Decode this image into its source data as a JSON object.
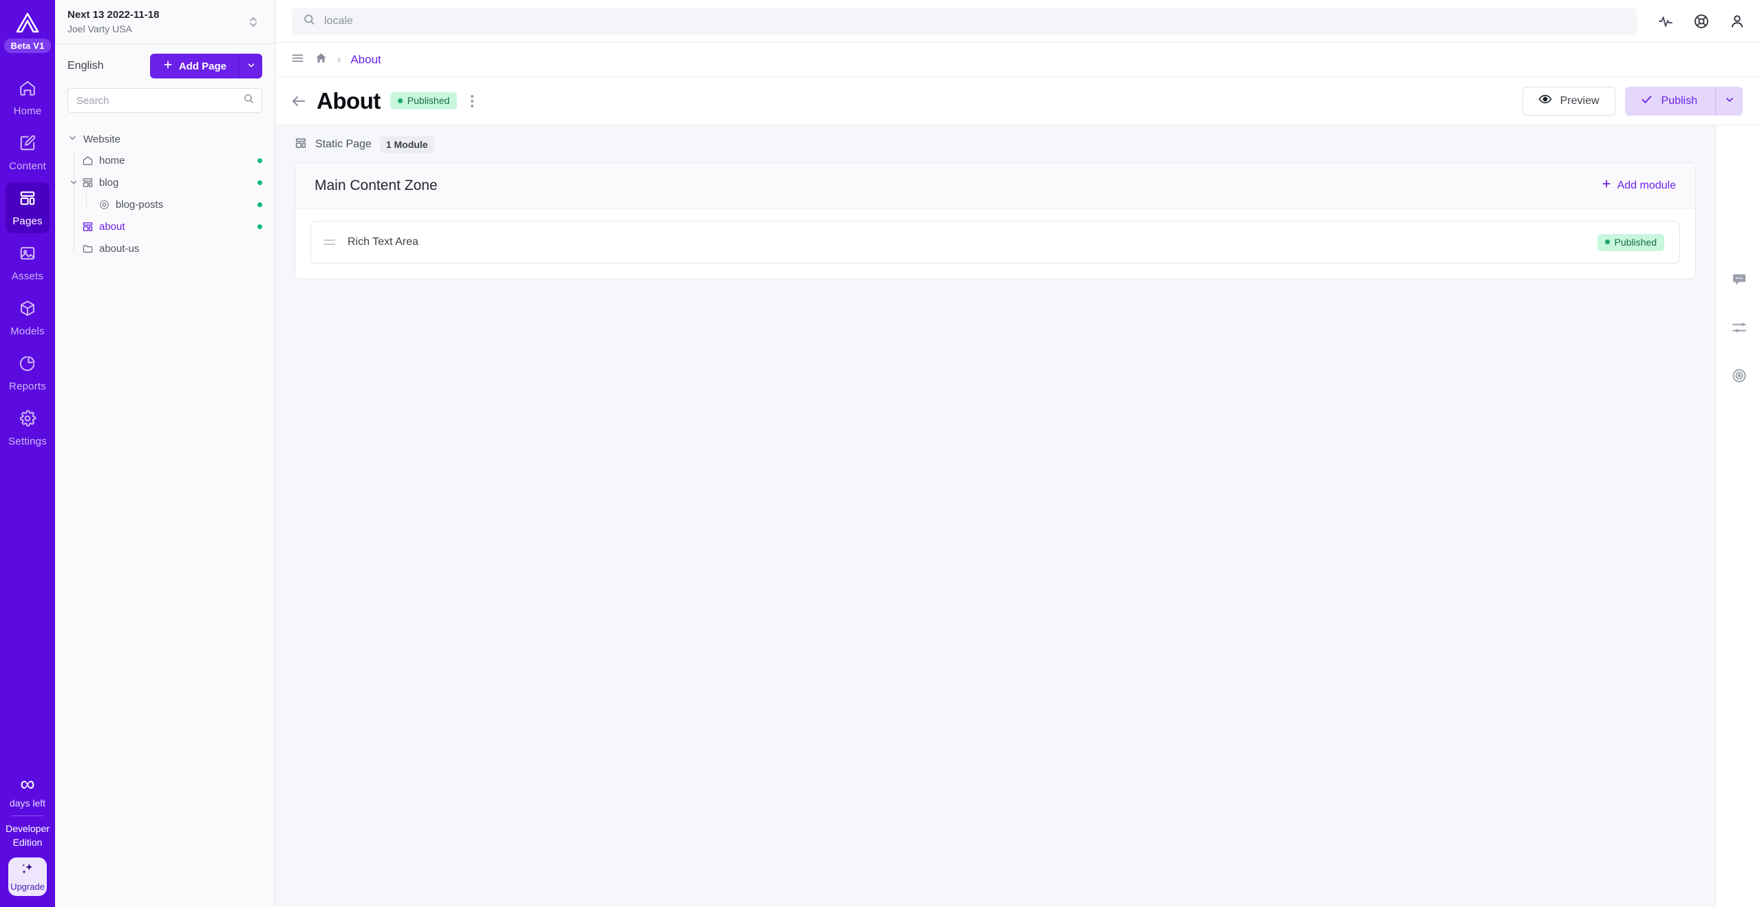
{
  "brand": {
    "beta_label": "Beta V1",
    "accent": "#6B21E8",
    "rail_bg": "#5B0BE0",
    "published_green": "#19A86B"
  },
  "rail": {
    "items": [
      {
        "label": "Home",
        "icon": "home-icon",
        "active": false
      },
      {
        "label": "Content",
        "icon": "edit-square-icon",
        "active": false
      },
      {
        "label": "Pages",
        "icon": "layout-icon",
        "active": true
      },
      {
        "label": "Assets",
        "icon": "image-icon",
        "active": false
      },
      {
        "label": "Models",
        "icon": "cube-icon",
        "active": false
      },
      {
        "label": "Reports",
        "icon": "pie-chart-icon",
        "active": false
      },
      {
        "label": "Settings",
        "icon": "gear-icon",
        "active": false
      }
    ],
    "footer": {
      "infinity": "∞",
      "days_left": "days left",
      "edition_line1": "Developer",
      "edition_line2": "Edition",
      "upgrade_label": "Upgrade"
    }
  },
  "tree_panel": {
    "site_name": "Next 13 2022-11-18",
    "site_sub": "Joel Varty USA",
    "language": "English",
    "add_page_label": "Add Page",
    "search_placeholder": "Search",
    "search_value": "",
    "root_label": "Website",
    "nodes": [
      {
        "label": "home",
        "icon": "home-icon",
        "level": 1,
        "selected": false,
        "expanded": false,
        "has_caret": false,
        "status_dot": true
      },
      {
        "label": "blog",
        "icon": "layout-icon",
        "level": 1,
        "selected": false,
        "expanded": true,
        "has_caret": true,
        "status_dot": true
      },
      {
        "label": "blog-posts",
        "icon": "dynamic-page-icon",
        "level": 2,
        "selected": false,
        "expanded": false,
        "has_caret": false,
        "status_dot": true
      },
      {
        "label": "about",
        "icon": "layout-icon",
        "level": 1,
        "selected": true,
        "expanded": false,
        "has_caret": false,
        "status_dot": true
      },
      {
        "label": "about-us",
        "icon": "folder-icon",
        "level": 1,
        "selected": false,
        "expanded": false,
        "has_caret": false,
        "status_dot": false
      }
    ]
  },
  "topbar": {
    "search_placeholder": "locale",
    "search_value": "",
    "icons": [
      "activity-icon",
      "lifebuoy-icon",
      "user-icon"
    ]
  },
  "breadcrumb": {
    "menu_icon": "hamburger-icon",
    "home_icon": "home-solid-icon",
    "separator": "›",
    "current": "About"
  },
  "page_header": {
    "title": "About",
    "status_badge": "Published",
    "preview_label": "Preview",
    "publish_label": "Publish"
  },
  "page_meta": {
    "type_label": "Static Page",
    "module_count_label": "1 Module"
  },
  "zone": {
    "title": "Main Content Zone",
    "add_module_label": "Add module",
    "modules": [
      {
        "name": "Rich Text Area",
        "status": "Published"
      }
    ]
  },
  "right_rail": {
    "icons": [
      "comment-icon",
      "sliders-icon",
      "target-icon"
    ]
  }
}
